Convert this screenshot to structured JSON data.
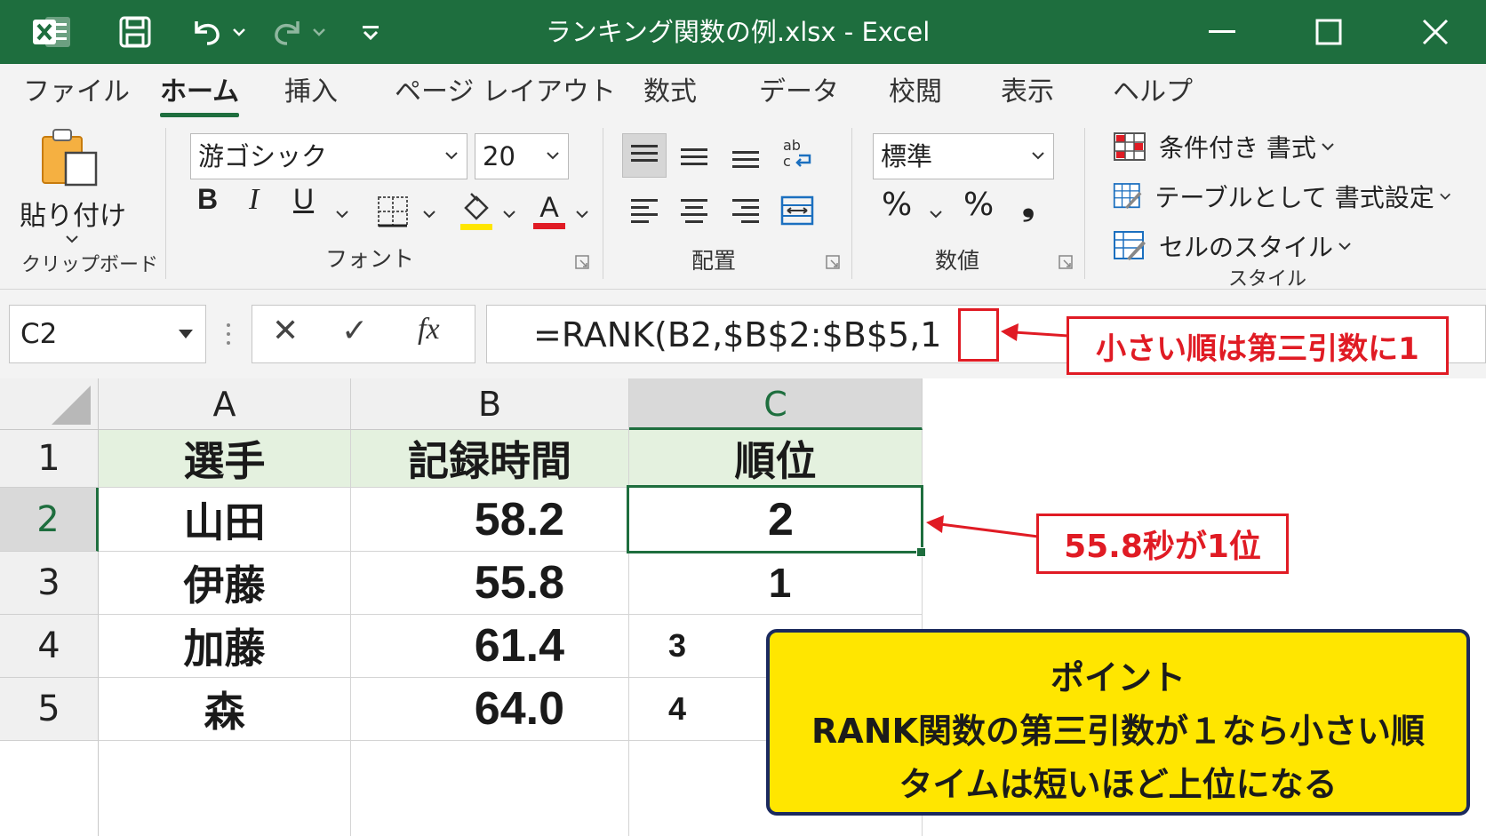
{
  "window": {
    "title": "ランキング関数の例.xlsx  -  Excel"
  },
  "tabs": [
    {
      "label": "ファイル"
    },
    {
      "label": "ホーム"
    },
    {
      "label": "挿入"
    },
    {
      "label": "ページ レイアウト"
    },
    {
      "label": "数式"
    },
    {
      "label": "データ"
    },
    {
      "label": "校閲"
    },
    {
      "label": "表示"
    },
    {
      "label": "ヘルプ"
    }
  ],
  "active_tab": "ホーム",
  "ribbon": {
    "clipboard": {
      "paste_label": "貼り付け",
      "group_label": "クリップボード"
    },
    "font": {
      "font_name": "游ゴシック",
      "font_size": "20",
      "bold": "B",
      "italic": "I",
      "underline": "U",
      "font_color_letter": "A",
      "group_label": "フォント",
      "highlight_color": "#ffe600",
      "font_color": "#e01b24"
    },
    "alignment": {
      "group_label": "配置"
    },
    "number": {
      "format": "標準",
      "percent1": "%",
      "percent2": "%",
      "comma": "❟",
      "group_label": "数値"
    },
    "styles": {
      "conditional": "条件付き 書式",
      "as_table": "テーブルとして 書式設定",
      "cell_styles": "セルのスタイル",
      "group_label": "スタイル"
    }
  },
  "formula_bar": {
    "name_box": "C2",
    "cancel_symbol": "✕",
    "enter_symbol": "✓",
    "fx_symbol": "fx",
    "formula": "=RANK(B2,$B$2:$B$5,1"
  },
  "sheet": {
    "columns": [
      "A",
      "B",
      "C"
    ],
    "rows": [
      "1",
      "2",
      "3",
      "4",
      "5"
    ],
    "header_row": {
      "a": "選手",
      "b": "記録時間",
      "c": "順位"
    },
    "data": [
      {
        "a": "山田",
        "b": "58.2",
        "c": "2"
      },
      {
        "a": "伊藤",
        "b": "55.8",
        "c": "1"
      },
      {
        "a": "加藤",
        "b": "61.4",
        "c": "3"
      },
      {
        "a": "森",
        "b": "64.0",
        "c": "4"
      }
    ],
    "selected_cell": "C2"
  },
  "annotations": {
    "formula_callout": "小さい順は第三引数に1",
    "rank_callout": "55.8秒が1位",
    "note_title": "ポイント",
    "note_line1": "RANK関数の第三引数が１なら小さい順",
    "note_line2": "タイムは短いほど上位になる",
    "accent_red": "#e01b24",
    "note_yellow": "#ffe600"
  },
  "colors": {
    "excel_green": "#1e6e3e",
    "header_fill": "#e4f1df"
  }
}
